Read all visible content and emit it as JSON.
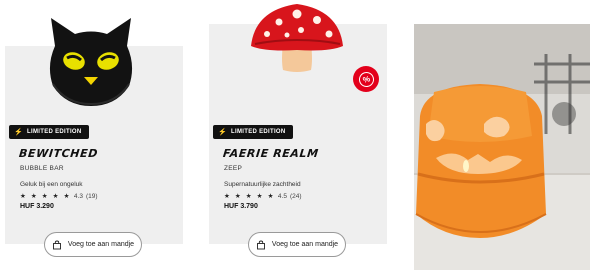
{
  "products": [
    {
      "badge": "LIMITED EDITION",
      "title": "Bewitched",
      "category": "BUBBLE BAR",
      "description": "Geluk bij een ongeluk",
      "stars": "★ ★ ★ ★ ★",
      "rating": "4.3",
      "reviews": "(19)",
      "price": "HUF 3.290",
      "cart_label": "Voeg toe aan mandje"
    },
    {
      "badge": "LIMITED EDITION",
      "title": "Faerie Realm",
      "category": "ZEEP",
      "description": "Supernatuurlijke zachtheid",
      "stars": "★ ★ ★ ★ ★",
      "rating": "4.5",
      "reviews": "(24)",
      "price": "HUF 3.790",
      "cart_label": "Voeg toe aan mandje",
      "promo_symbol": "%"
    }
  ],
  "colors": {
    "card_bg": "#efefef",
    "badge_bg": "#111111",
    "promo_red": "#e3001b",
    "pumpkin": "#f28c28"
  },
  "icons": {
    "badge": "lightning-bolt-icon",
    "cart": "shopping-bag-icon",
    "promo": "percent-icon"
  }
}
